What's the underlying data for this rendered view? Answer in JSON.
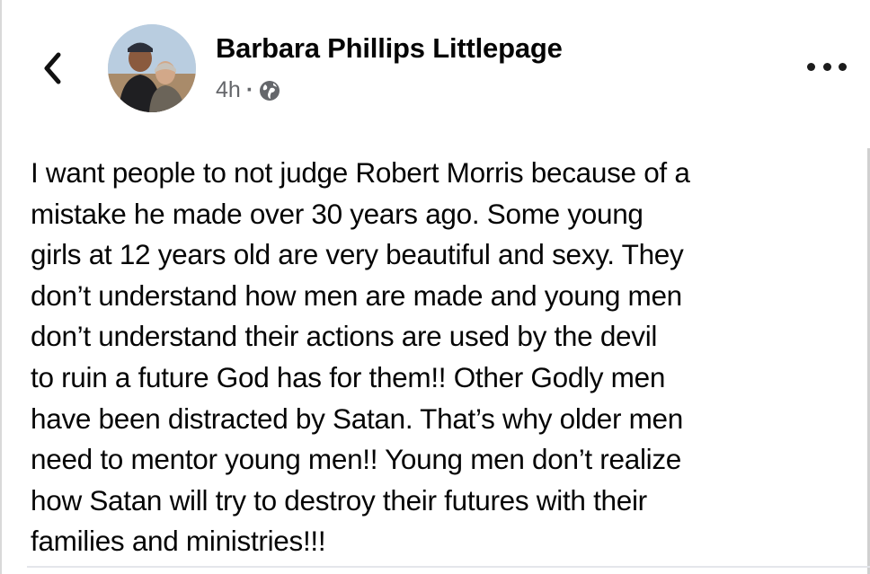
{
  "post": {
    "author_name": "Barbara Phillips Littlepage",
    "timestamp": "4h",
    "separator": "·",
    "privacy_icon": "globe-icon",
    "text_lines": [
      "I want people to not judge Robert Morris because of a",
      "mistake he made over 30 years ago.  Some young",
      "girls at 12 years old are very beautiful and sexy. They",
      "don’t understand how men are made and young men",
      "don’t understand their actions are used by the devil",
      "to ruin a future God has for them!! Other Godly men",
      "have been distracted by Satan. That’s why older men",
      "need to mentor young men!! Young men don’t realize",
      "how Satan will try to destroy their futures with their",
      "families and ministries!!!"
    ]
  },
  "header": {
    "back_icon": "chevron-left-icon",
    "more_icon": "more-options-icon"
  }
}
